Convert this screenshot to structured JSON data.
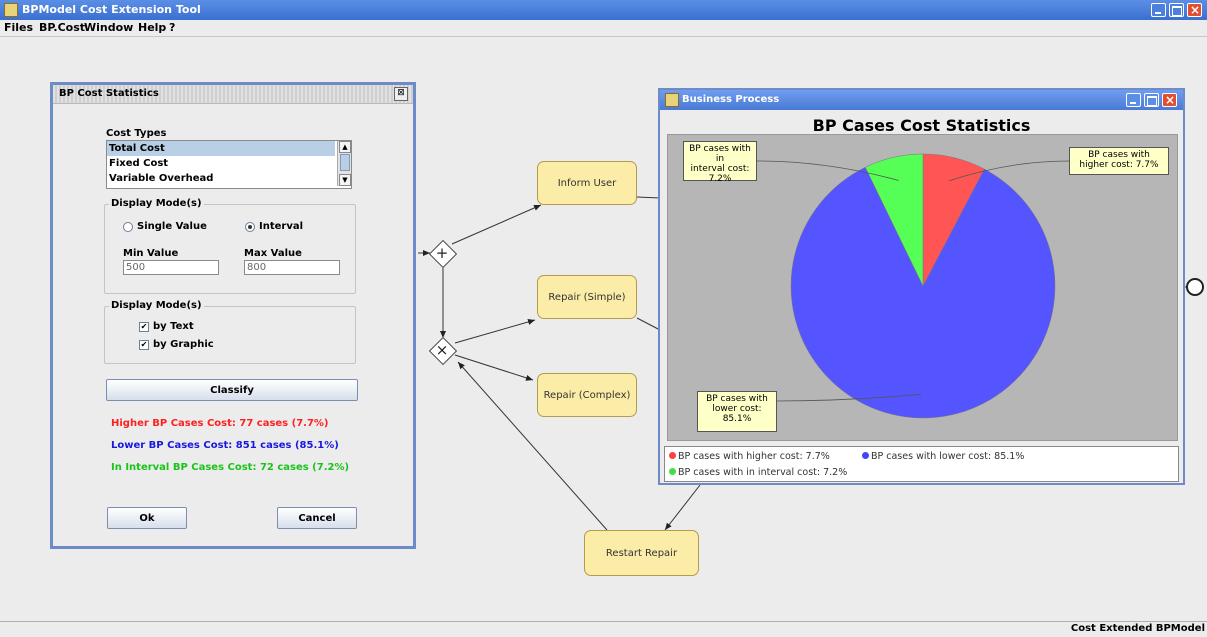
{
  "app": {
    "title": "BPModel Cost Extension Tool",
    "menu": [
      "Files",
      "BP.Cost",
      "Window",
      "Help",
      "?"
    ],
    "status_text": "Cost Extended BPModel"
  },
  "process": {
    "tasks": {
      "inform_user": "Inform User",
      "repair_simple": "Repair (Simple)",
      "repair_complex": "Repair (Complex)",
      "restart_repair": "Restart Repair"
    },
    "parallel_gateway_symbol": "+",
    "exclusive_gateway_symbol": "×"
  },
  "dialog": {
    "title": "BP Cost Statistics",
    "close_symbol": "⊠",
    "cost_types_label": "Cost Types",
    "cost_types": [
      "Total Cost",
      "Fixed Cost",
      "Variable Overhead"
    ],
    "selected_cost_type": "Total Cost",
    "display_mode_1": {
      "legend": "Display Mode(s)",
      "options": [
        "Single Value",
        "Interval"
      ],
      "selected": "Interval",
      "min_label": "Min Value",
      "min_value": "500",
      "max_label": "Max Value",
      "max_value": "800"
    },
    "display_mode_2": {
      "legend": "Display Mode(s)",
      "checks": [
        {
          "label": "by Text",
          "checked": true
        },
        {
          "label": "by Graphic",
          "checked": true
        }
      ]
    },
    "classify_label": "Classify",
    "results": {
      "higher": "Higher BP Cases Cost: 77 cases (7.7%)",
      "lower": "Lower BP Cases Cost: 851 cases (85.1%)",
      "interval": "In Interval BP Cases Cost: 72 cases (7.2%)"
    },
    "ok_label": "Ok",
    "cancel_label": "Cancel",
    "colors": {
      "higher": "#ff2020",
      "lower": "#1818e0",
      "interval": "#19c419"
    }
  },
  "bp_window": {
    "title": "Business Process",
    "chart_title": "BP Cases Cost Statistics",
    "callouts": {
      "higher": [
        "BP cases with",
        "higher cost: 7.7%"
      ],
      "interval": [
        "BP cases with in",
        "interval cost:",
        "7.2%"
      ],
      "lower": [
        "BP cases with",
        "lower cost:",
        "85.1%"
      ]
    },
    "legend": {
      "higher": "BP cases with higher cost: 7.7%",
      "lower": "BP cases with lower cost: 85.1%",
      "interval": "BP cases with in interval cost: 7.2%"
    }
  },
  "chart_data": {
    "type": "pie",
    "title": "BP Cases Cost Statistics",
    "categories": [
      "BP cases with higher cost",
      "BP cases with lower cost",
      "BP cases with in interval cost"
    ],
    "values": [
      7.7,
      85.1,
      7.2
    ],
    "colors": [
      "#ff5555",
      "#5555ff",
      "#55ff55"
    ],
    "legend_position": "bottom"
  }
}
